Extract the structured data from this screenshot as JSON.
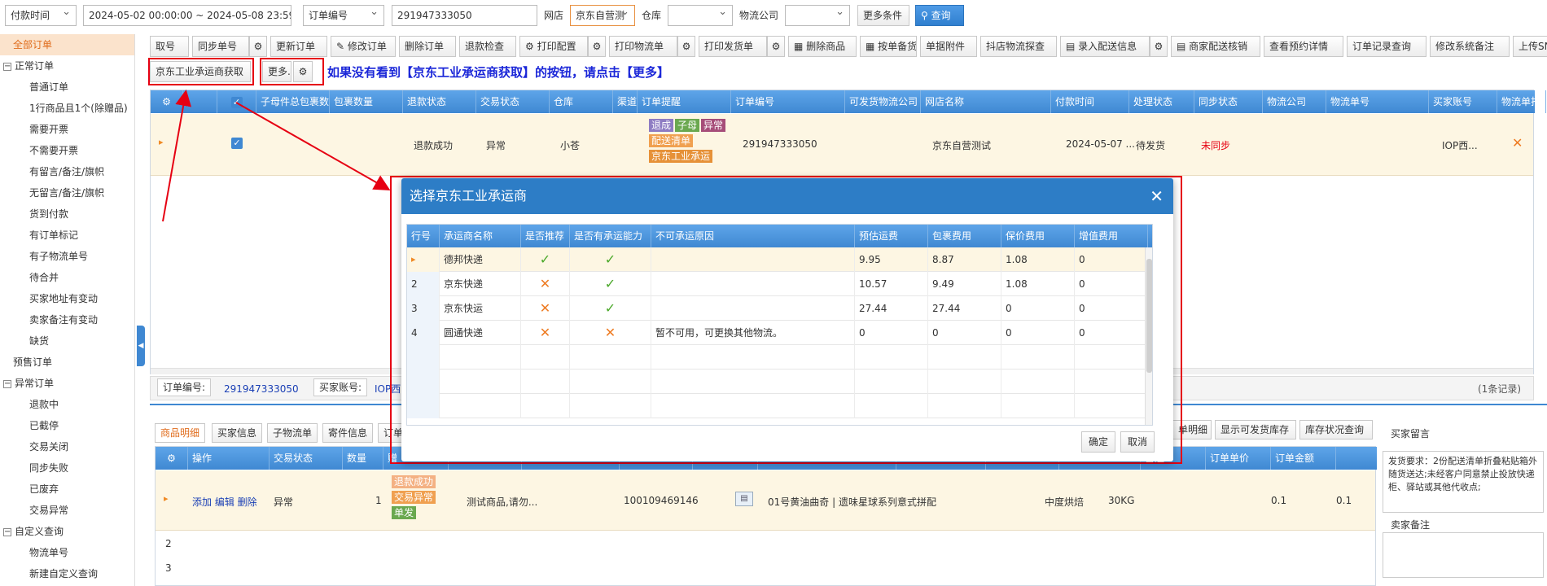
{
  "filters": {
    "time_type": "付款时间",
    "date_range": "2024-05-02 00:00:00 ~ 2024-05-08 23:59:59",
    "order_field": "订单编号",
    "order_value": "291947333050",
    "shop_label": "网店",
    "shop_value": "京东自营测",
    "warehouse_label": "仓库",
    "logistics_label": "物流公司",
    "more_label": "更多条件",
    "query_label": "查询"
  },
  "sidebar": {
    "items": [
      {
        "label": "全部订单",
        "kind": "top"
      },
      {
        "label": "正常订单",
        "kind": "grp"
      },
      {
        "label": "普通订单",
        "kind": "sub"
      },
      {
        "label": "1行商品且1个(除赠品)",
        "kind": "sub"
      },
      {
        "label": "需要开票",
        "kind": "sub"
      },
      {
        "label": "不需要开票",
        "kind": "sub"
      },
      {
        "label": "有留言/备注/旗帜",
        "kind": "sub"
      },
      {
        "label": "无留言/备注/旗帜",
        "kind": "sub"
      },
      {
        "label": "货到付款",
        "kind": "sub"
      },
      {
        "label": "有订单标记",
        "kind": "sub"
      },
      {
        "label": "有子物流单号",
        "kind": "sub"
      },
      {
        "label": "待合并",
        "kind": "sub"
      },
      {
        "label": "买家地址有变动",
        "kind": "sub"
      },
      {
        "label": "卖家备注有变动",
        "kind": "sub"
      },
      {
        "label": "缺货",
        "kind": "sub"
      },
      {
        "label": "预售订单",
        "kind": "lvl1"
      },
      {
        "label": "异常订单",
        "kind": "grp"
      },
      {
        "label": "退款中",
        "kind": "sub"
      },
      {
        "label": "已截停",
        "kind": "sub"
      },
      {
        "label": "交易关闭",
        "kind": "sub"
      },
      {
        "label": "同步失败",
        "kind": "sub"
      },
      {
        "label": "已废弃",
        "kind": "sub"
      },
      {
        "label": "交易异常",
        "kind": "sub"
      },
      {
        "label": "自定义查询",
        "kind": "grp"
      },
      {
        "label": "物流单号",
        "kind": "sub"
      },
      {
        "label": "新建自定义查询",
        "kind": "sub"
      }
    ]
  },
  "toolbar": {
    "row1": [
      "取号",
      "同步单号",
      "更新订单",
      "修改订单",
      "删除订单",
      "退款检查",
      "打印配置",
      "打印物流单",
      "打印发货单",
      "删除商品",
      "按单备货",
      "单据附件",
      "抖店物流探查",
      "录入配送信息",
      "商家配送核销",
      "查看预约详情",
      "订单记录查询",
      "修改系统备注",
      "上传SN"
    ],
    "jd_button": "京东工业承运商获取",
    "more_button": "更多..",
    "hint": "如果没有看到【京东工业承运商获取】的按钮，请点击【更多】"
  },
  "order_grid": {
    "headers": [
      "子母件总包裹数",
      "包裹数量",
      "退款状态",
      "交易状态",
      "仓库",
      "渠道",
      "订单提醒",
      "订单编号",
      "可发货物流公司",
      "网店名称",
      "付款时间",
      "处理状态",
      "同步状态",
      "物流公司",
      "物流单号",
      "买家账号",
      "物流单打"
    ],
    "row": {
      "refund_status": "退款成功",
      "trade_status": "异常",
      "warehouse": "小苍",
      "tags": [
        {
          "text": "退成",
          "color": "#8e7cc3"
        },
        {
          "text": "子母",
          "color": "#6aa84f"
        },
        {
          "text": "异常",
          "color": "#a64d79"
        },
        {
          "text": "配送清单",
          "color": "#f0a050"
        },
        {
          "text": "京东工业承运",
          "color": "#e69138"
        }
      ],
      "order_no": "291947333050",
      "shop": "京东自营测试",
      "pay_time": "2024-05-07 ...",
      "process_status": "待发货",
      "sync_status": "未同步",
      "buyer": "IOP西..."
    },
    "footer": {
      "order_label": "订单编号:",
      "order_value": "291947333050",
      "buyer_label": "买家账号:",
      "buyer_value": "IOP西",
      "count": "(1条记录)"
    }
  },
  "detail": {
    "tabs": [
      "商品明细",
      "买家信息",
      "子物流单",
      "寄件信息",
      "订单日"
    ],
    "right_buttons": [
      "单明细",
      "显示可发货库存",
      "库存状况查询"
    ],
    "headers": [
      "操作",
      "交易状态",
      "数量",
      "赠",
      "",
      "",
      "",
      "",
      "",
      "",
      "",
      "",
      "备注",
      "订单单价",
      "订单金额"
    ],
    "row": {
      "actions": "添加 编辑 删除",
      "trade_status": "异常",
      "qty": "1",
      "tags": [
        {
          "text": "退款成功",
          "color": "#f4b183"
        },
        {
          "text": "交易异常",
          "color": "#f0a050"
        },
        {
          "text": "单发",
          "color": "#6aa84f"
        }
      ],
      "goods_name_short": "测试商品,请勿...",
      "sku": "100109469146",
      "goods_name": "01号黄油曲奇 | 遗味星球系列意式拼配",
      "category": "中度烘焙",
      "weight": "30KG",
      "unit_price": "0.1",
      "amount": "0.1"
    },
    "row_numbers": [
      "2",
      "3"
    ],
    "buyer_msg_label": "买家留言",
    "buyer_msg": "发货要求：2份配送清单折叠粘贴箱外随货送达;未经客户同意禁止投放快递柜、驿站或其他代收点;",
    "seller_note_label": "卖家备注"
  },
  "modal": {
    "title": "选择京东工业承运商",
    "headers": [
      "行号",
      "承运商名称",
      "是否推荐",
      "是否有承运能力",
      "不可承运原因",
      "预估运费",
      "包裹费用",
      "保价费用",
      "增值费用"
    ],
    "rows": [
      {
        "no": "▸",
        "name": "德邦快递",
        "recommend": true,
        "capable": true,
        "reason": "",
        "est": "9.95",
        "pkg": "8.87",
        "ins": "1.08",
        "add": "0"
      },
      {
        "no": "2",
        "name": "京东快递",
        "recommend": false,
        "capable": true,
        "reason": "",
        "est": "10.57",
        "pkg": "9.49",
        "ins": "1.08",
        "add": "0"
      },
      {
        "no": "3",
        "name": "京东快运",
        "recommend": false,
        "capable": true,
        "reason": "",
        "est": "27.44",
        "pkg": "27.44",
        "ins": "0",
        "add": "0"
      },
      {
        "no": "4",
        "name": "圆通快递",
        "recommend": false,
        "capable": false,
        "reason": "暂不可用，可更换其他物流。",
        "est": "0",
        "pkg": "0",
        "ins": "0",
        "add": "0"
      }
    ],
    "confirm": "确定",
    "cancel": "取消"
  }
}
